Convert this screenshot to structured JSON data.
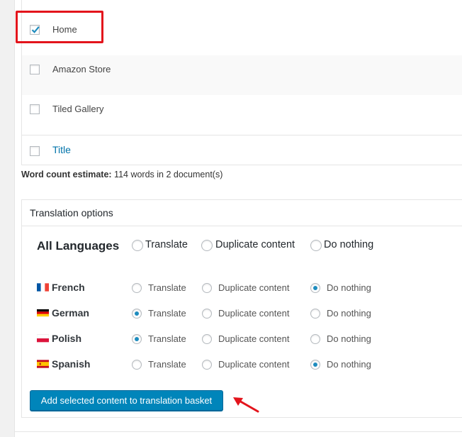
{
  "list": {
    "items": [
      {
        "label": "Home",
        "checked": true
      },
      {
        "label": "Amazon Store",
        "checked": false
      },
      {
        "label": "Tiled Gallery",
        "checked": false
      }
    ],
    "footer_label": "Title"
  },
  "word_count": {
    "label": "Word count estimate:",
    "value": "114 words in 2 document(s)"
  },
  "translation_options": {
    "title": "Translation options",
    "all_languages": {
      "label": "All Languages",
      "options": [
        "Translate",
        "Duplicate content",
        "Do nothing"
      ]
    },
    "languages": [
      {
        "name": "French",
        "flag": "fr-flag-icon",
        "translate": "Translate",
        "duplicate": "Duplicate content",
        "nothing": "Do nothing",
        "selected": "Do nothing"
      },
      {
        "name": "German",
        "flag": "de-flag-icon",
        "translate": "Translate",
        "duplicate": "Duplicate content",
        "nothing": "Do nothing",
        "selected": "Translate"
      },
      {
        "name": "Polish",
        "flag": "pl-flag-icon",
        "translate": "Translate",
        "duplicate": "Duplicate content",
        "nothing": "Do nothing",
        "selected": "Translate"
      },
      {
        "name": "Spanish",
        "flag": "es-flag-icon",
        "translate": "Translate",
        "duplicate": "Duplicate content",
        "nothing": "Do nothing",
        "selected": "Do nothing"
      }
    ],
    "button_label": "Add selected content to translation basket"
  },
  "colors": {
    "accent": "#0085ba",
    "highlight": "#e3141c",
    "link": "#0073aa"
  }
}
